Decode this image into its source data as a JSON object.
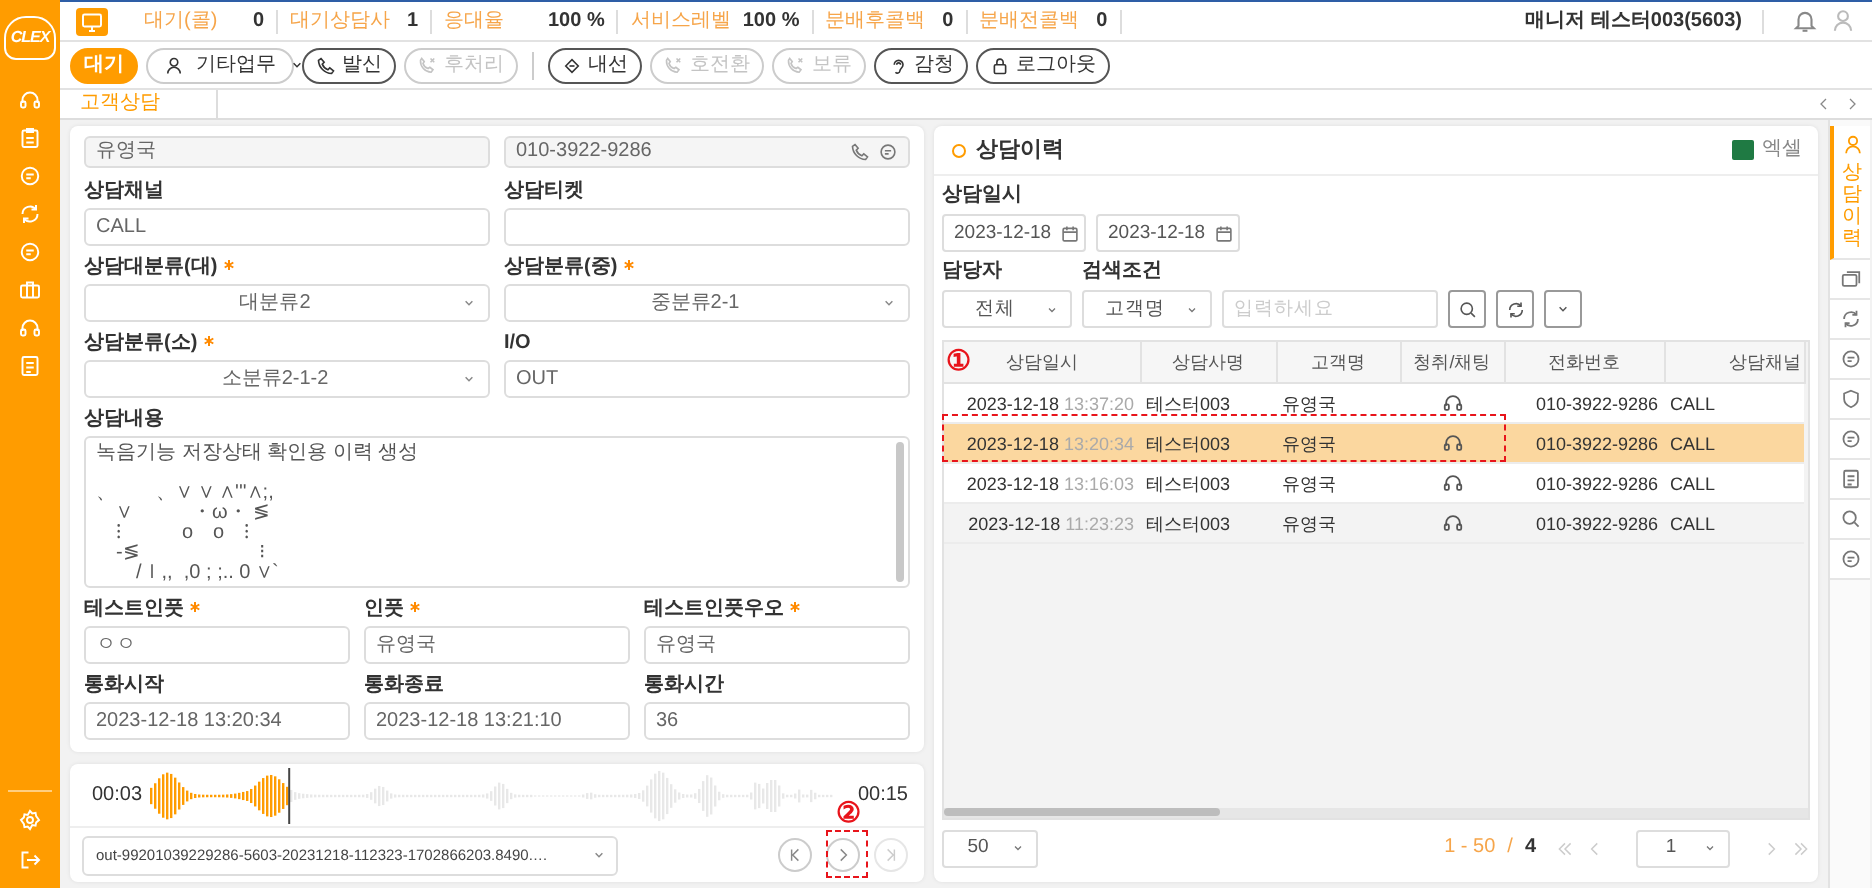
{
  "logo": "CLEX",
  "stats": [
    {
      "label": "대기(콜)",
      "value": "0"
    },
    {
      "label": "대기상담사",
      "value": "1"
    },
    {
      "label": "응대율",
      "value": "100 %"
    },
    {
      "label": "서비스레벨",
      "value": "100 %"
    },
    {
      "label": "분배후콜백",
      "value": "0"
    },
    {
      "label": "분배전콜백",
      "value": "0"
    }
  ],
  "agent": "매니저 테스터003(5603)",
  "toolbar": {
    "status": "대기",
    "work": "기타업무",
    "left": [
      {
        "label": "발신",
        "disabled": false
      },
      {
        "label": "후처리",
        "disabled": true
      }
    ],
    "right": [
      {
        "label": "내선",
        "disabled": false
      },
      {
        "label": "호전환",
        "disabled": true
      },
      {
        "label": "보류",
        "disabled": true
      },
      {
        "label": "감청",
        "disabled": false
      },
      {
        "label": "로그아웃",
        "disabled": false
      }
    ]
  },
  "tabs": [
    {
      "label": "고객상담",
      "selected": true
    }
  ],
  "form": {
    "contact": [
      {
        "kind": "input",
        "value": "유영국"
      },
      {
        "kind": "phone",
        "value": "010-3922-9286"
      }
    ],
    "rows": [
      [
        {
          "label": "상담채널",
          "required": false,
          "kind": "input",
          "value": "CALL"
        },
        {
          "label": "상담티켓",
          "required": false,
          "kind": "input"
        }
      ],
      [
        {
          "label": "상담대분류(대)",
          "required": true,
          "kind": "select",
          "value": "대분류2"
        },
        {
          "label": "상담분류(중)",
          "required": true,
          "kind": "select",
          "value": "중분류2-1"
        }
      ],
      [
        {
          "label": "상담분류(소)",
          "required": true,
          "kind": "select",
          "value": "소분류2-1-2"
        },
        {
          "label": "I/O",
          "required": false,
          "kind": "input",
          "value": "OUT"
        }
      ]
    ],
    "memo": {
      "label": "상담내용",
      "value": "녹음기능 저장상태 확인용 이력 생성\n\n、　　、∨ ∨ ∧'''∧;,\n　∨　　　・ω・ ≶\n　⁝　　　o　o　⁝\n　-≶　　　　　　⁝\n　　/ｌ,,  ,0 ; ;.. 0 ∨`"
    },
    "rows3": [
      [
        {
          "label": "테스트인풋",
          "required": true,
          "kind": "input",
          "value": "ㅇㅇ"
        },
        {
          "label": "인풋",
          "required": true,
          "kind": "input",
          "value": "유영국"
        },
        {
          "label": "테스트인풋우오",
          "required": true,
          "kind": "input",
          "value": "유영국"
        }
      ],
      [
        {
          "label": "통화시작",
          "required": false,
          "kind": "input",
          "value": "2023-12-18 13:20:34"
        },
        {
          "label": "통화종료",
          "required": false,
          "kind": "input",
          "value": "2023-12-18 13:21:10"
        },
        {
          "label": "통화시간",
          "required": false,
          "kind": "input",
          "value": "36"
        }
      ]
    ]
  },
  "player": {
    "elapsed": "00:03",
    "duration": "00:15",
    "level": 0.2,
    "file": "out-99201039229286-5603-20231218-112323-1702866203.8490.…"
  },
  "history": {
    "title": "상담이력",
    "excel": "엑셀",
    "date_label": "상담일시",
    "date_from": "2023-12-18",
    "date_to": "2023-12-18",
    "agent_label": "담당자",
    "agent_value": "전체",
    "condition_label": "검색조건",
    "condition_value": "고객명",
    "search_placeholder": "입력하세요",
    "columns": [
      "상담일시",
      "상담사명",
      "고객명",
      "청취/채팅",
      "전화번호",
      "상담채널"
    ],
    "rows": [
      {
        "date": "2023-12-18",
        "time": "13:37:20",
        "agent": "테스터003",
        "customer": "유영국",
        "phone": "010-3922-9286",
        "channel": "CALL",
        "selected": false
      },
      {
        "date": "2023-12-18",
        "time": "13:20:34",
        "agent": "테스터003",
        "customer": "유영국",
        "phone": "010-3922-9286",
        "channel": "CALL",
        "selected": true
      },
      {
        "date": "2023-12-18",
        "time": "13:16:03",
        "agent": "테스터003",
        "customer": "유영국",
        "phone": "010-3922-9286",
        "channel": "CALL",
        "selected": false
      },
      {
        "date": "2023-12-18",
        "time": "11:23:23",
        "agent": "테스터003",
        "customer": "유영국",
        "phone": "010-3922-9286",
        "channel": "CALL",
        "selected": false
      }
    ],
    "page_size": "50",
    "range": "1 - 50",
    "slash": "/",
    "total": "4",
    "page": "1"
  },
  "side_tabs": [
    {
      "label": "상담이력",
      "selected": true
    },
    {
      "selected": false
    },
    {
      "selected": false
    },
    {
      "selected": false
    },
    {
      "selected": false
    },
    {
      "selected": false
    },
    {
      "selected": false
    },
    {
      "selected": false
    },
    {
      "selected": false
    }
  ],
  "annotations": [
    {
      "label": "①"
    },
    {
      "label": "②"
    }
  ]
}
